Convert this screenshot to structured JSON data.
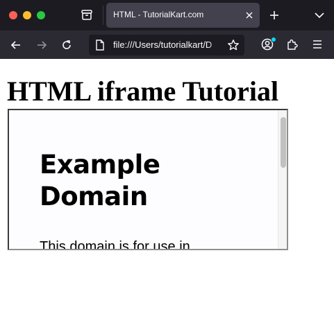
{
  "browser": {
    "tab": {
      "title": "HTML - TutorialKart.com"
    },
    "address_bar": {
      "url": "file:///Users/tutorialkart/D"
    },
    "icons": {
      "window_controls": [
        "close-window-icon",
        "minimize-window-icon",
        "zoom-window-icon"
      ],
      "tab_overview": "tab-overview-icon",
      "tab_close": "close-icon",
      "new_tab": "plus-icon",
      "tab_list": "chevron-down-icon",
      "back": "arrow-left-icon",
      "forward": "arrow-right-icon",
      "reload": "reload-icon",
      "page": "page-icon",
      "bookmark": "star-icon",
      "account": "account-icon",
      "extensions": "puzzle-icon",
      "menu": "hamburger-menu-icon"
    },
    "colors": {
      "tabbar_bg": "#1c1b22",
      "navbar_bg": "#2b2a33",
      "active_tab_bg": "#42414d",
      "account_badge": "#00ddff"
    }
  },
  "page": {
    "heading": "HTML iframe Tutorial",
    "iframe": {
      "heading": "Example Domain",
      "paragraph": "This domain is for use in"
    }
  }
}
